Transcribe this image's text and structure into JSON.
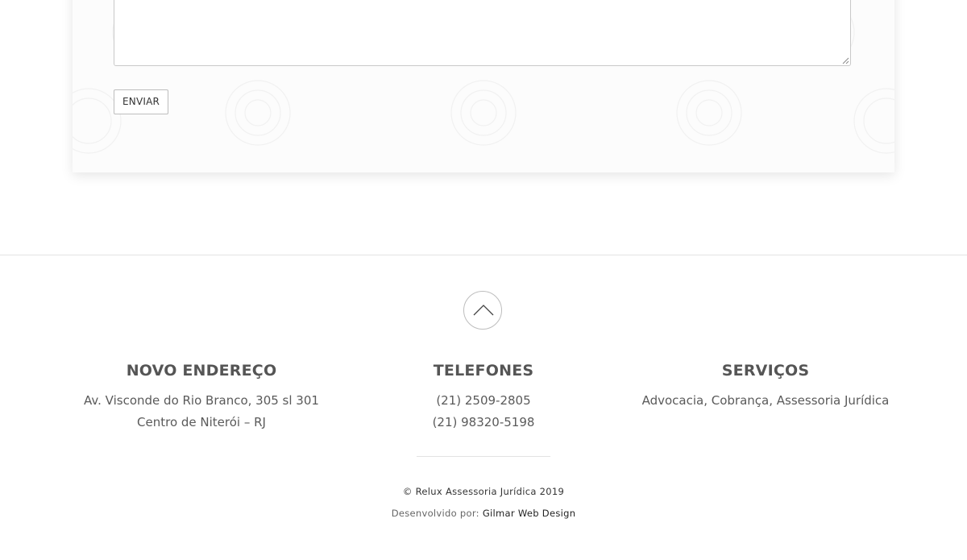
{
  "form": {
    "message_value": "",
    "send_label": "ENVIAR"
  },
  "footer": {
    "back_to_top_icon": "chevron-up-icon",
    "columns": [
      {
        "heading": "NOVO ENDEREÇO",
        "lines": [
          "Av. Visconde do Rio Branco, 305 sl 301",
          "Centro de Niterói – RJ"
        ]
      },
      {
        "heading": "TELEFONES",
        "lines": [
          "(21) 2509-2805",
          "(21) 98320-5198"
        ]
      },
      {
        "heading": "SERVIÇOS",
        "lines": [
          "Advocacia, Cobrança, Assessoria Jurídica"
        ]
      }
    ],
    "copyright": "© Relux Assessoria Jurídica 2019",
    "credits_prefix": "Desenvolvido por:",
    "credits_link": "Gilmar Web Design"
  },
  "colors": {
    "text": "#555555",
    "divider": "#e3e3e3",
    "border": "#bdbdbd"
  }
}
